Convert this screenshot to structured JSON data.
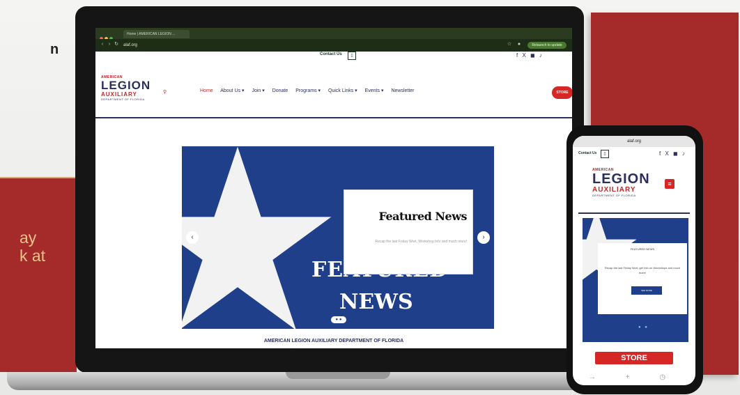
{
  "backdrop": {
    "top_text": "n",
    "red_text_line1": "ay",
    "red_text_line2": "k at"
  },
  "browser": {
    "tab_label": "Home | AMERICAN LEGION ...",
    "url": "alaf.org",
    "update_label": "Relaunch to update"
  },
  "site": {
    "contact_label": "Contact Us",
    "socials": "f X ◼ ♪",
    "logo": {
      "small": "AMERICAN",
      "main": "LEGION",
      "aux": "AUXILIARY",
      "dept": "DEPARTMENT OF FLORIDA"
    },
    "nav": [
      "Home",
      "About Us ▾",
      "Join ▾",
      "Donate",
      "Programs ▾",
      "Quick Links ▾",
      "Events ▾",
      "Newsletter"
    ],
    "store_label": "STORE",
    "hero": {
      "card_title": "Featured News",
      "card_desc": "Recap the last Friday Wort, Workshop Info and much more!",
      "big_line1": "FEATURED",
      "big_line2": "NEWS",
      "prev": "‹",
      "next": "›",
      "dots": "● ●"
    },
    "footer_heading": "AMERICAN LEGION AUXILIARY DEPARTMENT OF FLORIDA"
  },
  "phone": {
    "url": "alaf.org",
    "contact_label": "Contact Us",
    "menu": "≡",
    "card_top": "FEATURED NEWS",
    "card_desc": "Recap the last Friday Wort, get Info on Workshops and much more!",
    "card_btn": "SEE MORE",
    "dots": "● ●",
    "store_label": "STORE",
    "bottom_icons": "→ + ◷ ⋯"
  },
  "colors": {
    "brand_red": "#a52a2a",
    "nav_blue": "#2b2f5a",
    "hero_blue": "#1f3f8a"
  }
}
